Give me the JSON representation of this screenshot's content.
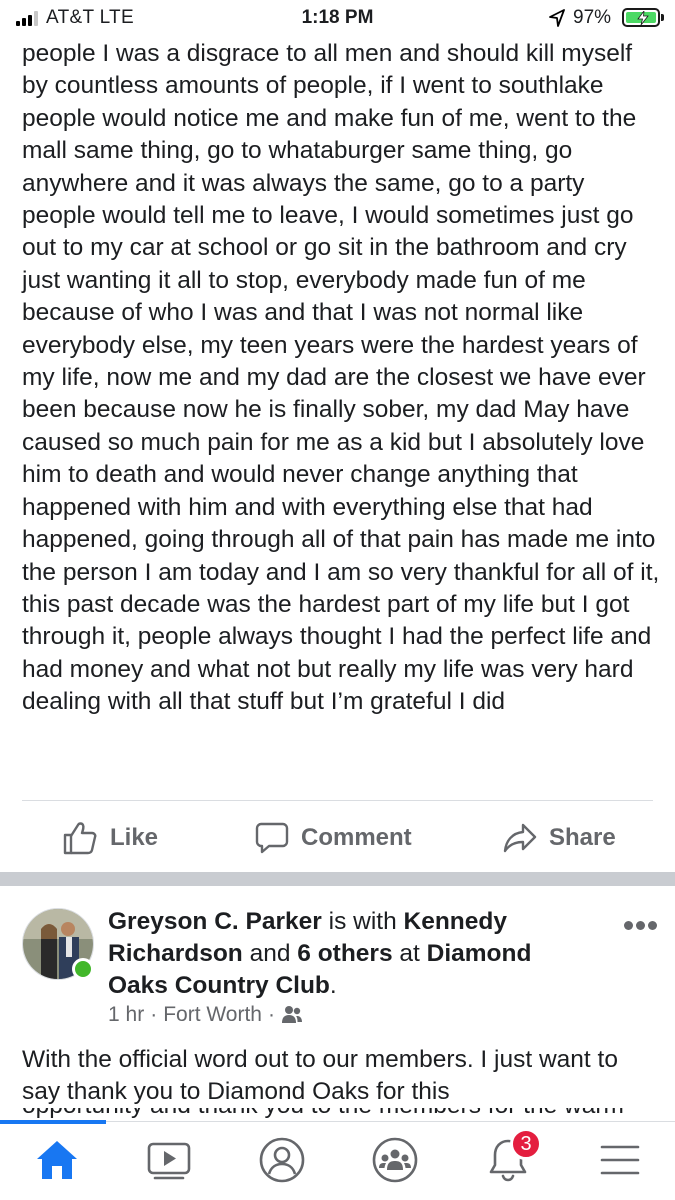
{
  "status_bar": {
    "carrier": "AT&T  LTE",
    "time": "1:18 PM",
    "battery_percent": "97%",
    "signal_bars": 3,
    "icons": [
      "signal-icon",
      "location-arrow-icon",
      "battery-charging-icon"
    ]
  },
  "post1": {
    "text": "people I was a disgrace to all men and should kill myself by countless amounts of people, if I went to southlake people would notice me and make fun of me, went to the mall same thing, go to whataburger same thing, go anywhere and it was always the same, go to a party people would tell me to leave, I would sometimes just go out to my car at school or go sit in the bathroom and cry just wanting it all to stop, everybody made fun of me because of who I was and that I was not normal like everybody else, my teen years were the hardest years of my life, now me and my dad are the closest we have ever been because now he is finally sober, my dad May have caused so much pain for me as a kid but I absolutely love him to death and would never change anything that happened with him and with everything else that had happened, going through all of that pain has made me into the person I am today and I am so very thankful for all of it, this past decade was the hardest part of my life but I got through it, people always thought I had the perfect life and had money and what not but really my life was very hard dealing with all that stuff but I’m grateful I did",
    "actions": {
      "like": "Like",
      "comment": "Comment",
      "share": "Share"
    }
  },
  "post2": {
    "author": "Greyson C. Parker",
    "is_with": " is with ",
    "tagged": "Kennedy Richardson",
    "and": " and ",
    "others": "6 others",
    "at": " at ",
    "place": "Diamond Oaks Country Club",
    "period": ".",
    "time": "1 hr",
    "location": "Fort Worth",
    "separator": "·",
    "text": "With the official word out to our members. I just want to say thank you to Diamond Oaks for this",
    "text_cut": "opportunity and thank you to the members for the warm welcoming"
  },
  "tabbar": {
    "tabs": [
      "home",
      "watch",
      "profile",
      "groups",
      "notifications",
      "menu"
    ],
    "active": "home",
    "notification_count": "3"
  },
  "colors": {
    "accent": "#1877f2",
    "secondary_text": "#65676b",
    "online": "#42b72a",
    "badge": "#e41e3f",
    "battery": "#4cd964"
  }
}
